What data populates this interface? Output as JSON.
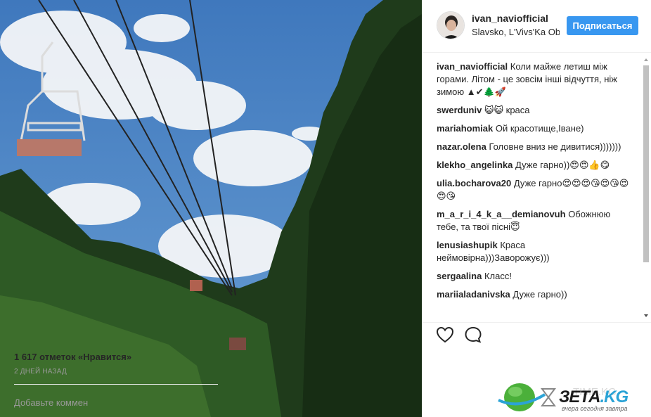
{
  "post": {
    "username": "ivan_naviofficial",
    "location": "Slavsko, L'Vivs'Ka Oblast', Ukraine",
    "follow_label": "Подписаться",
    "likes_text": "1 617 отметок «Нравится»",
    "date_text": "2 ДНЕЙ НАЗАД",
    "comment_placeholder": "Добавьте комментарий..."
  },
  "comments": [
    {
      "user": "ivan_naviofficial",
      "text": "Коли майже летиш між горами. Літом - це зовсім інші відчуття, ніж зимою ▲✔🌲🚀"
    },
    {
      "user": "swerduniv",
      "text": "😺😺 краса"
    },
    {
      "user": "mariahomiak",
      "text": "Ой красотище,Іване)"
    },
    {
      "user": "nazar.olena",
      "text": "Головне вниз не дивитися)))))))"
    },
    {
      "user": "klekho_angelinka",
      "text": "Дуже гарно))😍😍👍😋"
    },
    {
      "user": "ulia.bocharova20",
      "text": "Дуже гарно😍😍😍😘😍😘😍😍😘"
    },
    {
      "user": "m_a_r_i_4_k_a__demianovuh",
      "text": "Обожнюю тебе, та твої пісні😇"
    },
    {
      "user": "lenusiashupik",
      "text": "Краса неймовірна)))Заворожує)))"
    },
    {
      "user": "sergaalina",
      "text": "Класс!"
    },
    {
      "user": "mariialadanivska",
      "text": "Дуже гарно))"
    }
  ],
  "icons": {
    "like": "heart-outline-icon",
    "comment": "speech-bubble-icon"
  },
  "watermark": {
    "brand_a": "ЗЕТА",
    "brand_b": ".KG",
    "ghost": "TIME.KG",
    "tagline": "вчера сегодня завтра"
  },
  "colors": {
    "follow_button": "#3897f0",
    "sky": "#4f86c6",
    "forest": "#1e3a1a"
  }
}
